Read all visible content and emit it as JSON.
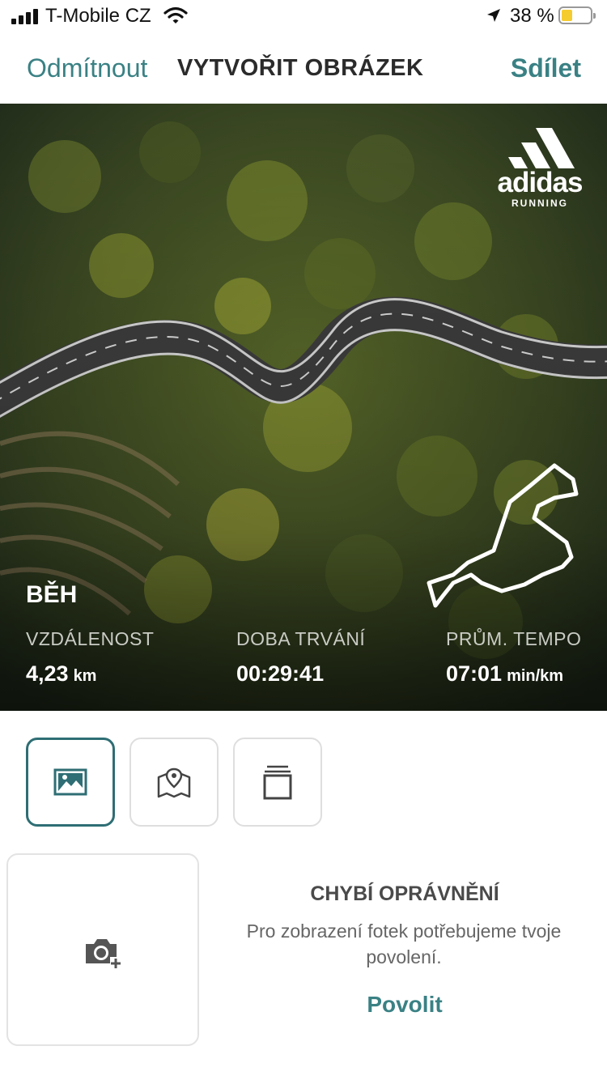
{
  "status_bar": {
    "carrier": "T-Mobile CZ",
    "battery_percent": "38 %",
    "battery_level": 0.38,
    "battery_color": "#f5cc30",
    "icons": [
      "signal-icon",
      "wifi-icon",
      "location-arrow-icon",
      "battery-icon"
    ]
  },
  "navbar": {
    "cancel_label": "Odmítnout",
    "title": "VYTVOŘIT OBRÁZEK",
    "share_label": "Sdílet",
    "accent_color": "#3a8184"
  },
  "preview": {
    "brand_name": "adidas",
    "brand_sub": "RUNNING",
    "activity": "BĚH",
    "stats": [
      {
        "label": "VZDÁLENOST",
        "value": "4,23",
        "unit": "km"
      },
      {
        "label": "DOBA TRVÁNÍ",
        "value": "00:29:41",
        "unit": ""
      },
      {
        "label": "PRŮM. TEMPO",
        "value": "07:01",
        "unit": "min/km"
      }
    ]
  },
  "modes": [
    {
      "icon": "image-icon",
      "active": true
    },
    {
      "icon": "map-pin-icon",
      "active": false
    },
    {
      "icon": "stack-icon",
      "active": false
    }
  ],
  "permission": {
    "title": "CHYBÍ OPRÁVNĚNÍ",
    "text": "Pro zobrazení fotek potřebujeme tvoje povolení.",
    "action_label": "Povolit",
    "camera_icon": "camera-add-icon"
  }
}
